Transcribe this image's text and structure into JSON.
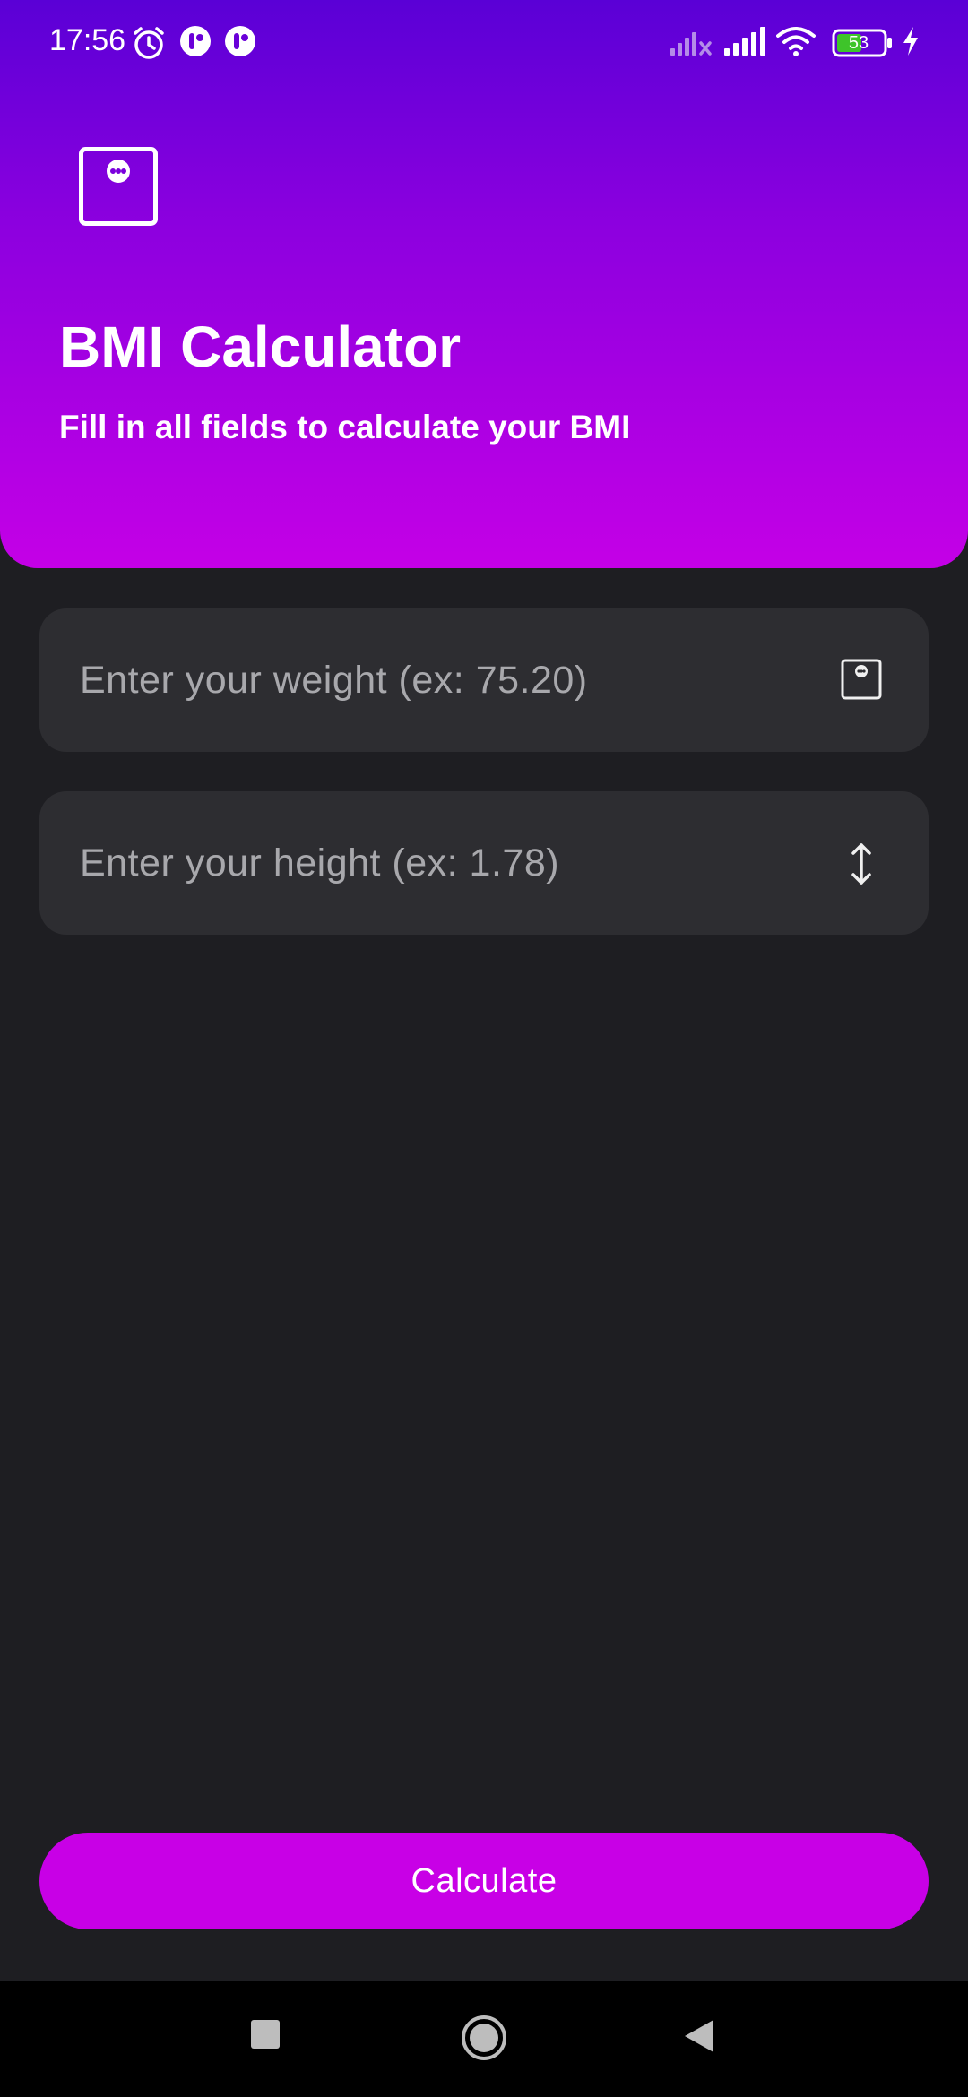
{
  "status_bar": {
    "time": "17:56",
    "battery_level": "53",
    "icons": [
      "alarm-icon",
      "app-icon",
      "app-icon",
      "signal-off-icon",
      "signal-icon",
      "wifi-icon",
      "battery-icon",
      "charging-icon"
    ]
  },
  "header": {
    "logo_icon": "scale-icon",
    "title": "BMI Calculator",
    "subtitle": "Fill in all fields to calculate your BMI"
  },
  "form": {
    "weight": {
      "placeholder": "Enter your weight (ex: 75.20)",
      "value": "",
      "icon": "scale-icon"
    },
    "height": {
      "placeholder": "Enter your height (ex: 1.78)",
      "value": "",
      "icon": "vertical-arrows-icon"
    },
    "submit_label": "Calculate"
  },
  "nav": {
    "items": [
      "recents-button",
      "home-button",
      "back-button"
    ]
  },
  "colors": {
    "header_gradient_top": "#5a00d6",
    "header_gradient_bottom": "#c400e6",
    "accent": "#c800e6",
    "background": "#1e1e22",
    "field_background": "#2d2d31"
  }
}
